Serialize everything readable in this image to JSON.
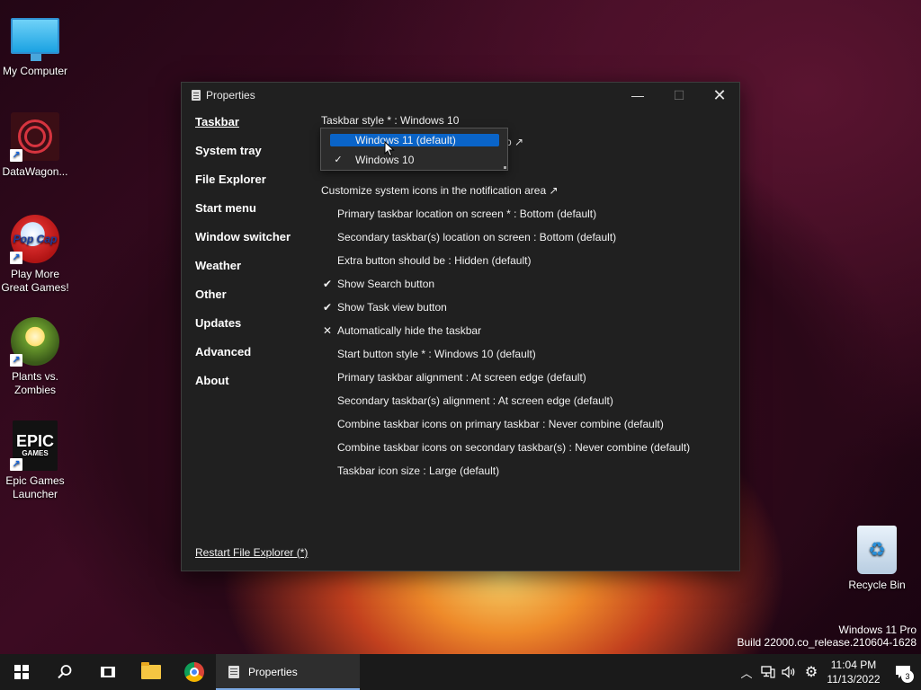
{
  "desktop": {
    "icons": [
      {
        "label": "My Computer",
        "icon": "computer-icon"
      },
      {
        "label": "DataWagon...",
        "icon": "datawagon-icon"
      },
      {
        "label": "Play More Great Games!",
        "icon": "popcap-icon"
      },
      {
        "label": "Plants vs. Zombies",
        "icon": "plants-vs-zombies-icon"
      },
      {
        "label": "Epic Games Launcher",
        "icon": "epic-games-icon"
      },
      {
        "label": "Recycle Bin",
        "icon": "recycle-bin-icon"
      }
    ],
    "epic_logo_top": "EPIC",
    "epic_logo_bottom": "GAMES",
    "popcap_logo": "Pop Cap",
    "watermark": {
      "line1": "Windows 11 Pro",
      "line2": "Build 22000.co_release.210604-1628"
    }
  },
  "window": {
    "title": "Properties",
    "controls": {
      "minimize": "—",
      "maximize": "☐",
      "close": "✕"
    },
    "nav": [
      {
        "label": "Taskbar",
        "active": true
      },
      {
        "label": "System tray"
      },
      {
        "label": "File Explorer"
      },
      {
        "label": "Start menu"
      },
      {
        "label": "Window switcher"
      },
      {
        "label": "Weather"
      },
      {
        "label": "Other"
      },
      {
        "label": "Updates"
      },
      {
        "label": "Advanced"
      },
      {
        "label": "About"
      }
    ],
    "restart_link": "Restart File Explorer (*)",
    "settings": {
      "taskbar_style": "Taskbar style * : Windows 10",
      "hidden_fragment": "p ↗",
      "customize_icons": "Customize system icons in the notification area ↗",
      "items": [
        {
          "mark": "",
          "text": "Primary taskbar location on screen * : Bottom (default)"
        },
        {
          "mark": "",
          "text": "Secondary taskbar(s) location on screen : Bottom (default)"
        },
        {
          "mark": "",
          "text": "Extra button should be : Hidden (default)"
        },
        {
          "mark": "✔",
          "text": "Show Search button"
        },
        {
          "mark": "✔",
          "text": "Show Task view button"
        },
        {
          "mark": "✕",
          "text": "Automatically hide the taskbar"
        },
        {
          "mark": "",
          "text": "Start button style * : Windows 10 (default)"
        },
        {
          "mark": "",
          "text": "Primary taskbar alignment : At screen edge (default)"
        },
        {
          "mark": "",
          "text": "Secondary taskbar(s) alignment : At screen edge (default)"
        },
        {
          "mark": "",
          "text": "Combine taskbar icons on primary taskbar : Never combine (default)"
        },
        {
          "mark": "",
          "text": "Combine taskbar icons on secondary taskbar(s) : Never combine (default)"
        },
        {
          "mark": "",
          "text": "Taskbar icon size : Large (default)"
        }
      ]
    },
    "dropdown": {
      "options": [
        {
          "label": "Windows 11 (default)",
          "highlighted": true,
          "checked": false
        },
        {
          "label": "Windows 10",
          "highlighted": false,
          "checked": true
        }
      ],
      "check_glyph": "✓"
    }
  },
  "taskbar": {
    "search_icon": "🔍",
    "running_app": "Properties",
    "tray": {
      "chevron": "︿",
      "network_icon": "🖧",
      "volume_icon": "🔊",
      "settings_icon": "⚙",
      "time": "11:04 PM",
      "date": "11/13/2022",
      "notification_count": "3",
      "notification_icon": "🗨"
    }
  },
  "colors": {
    "window_bg": "#202020",
    "accent": "#0a64c8",
    "taskbar_bg": "#1a1a1a"
  }
}
